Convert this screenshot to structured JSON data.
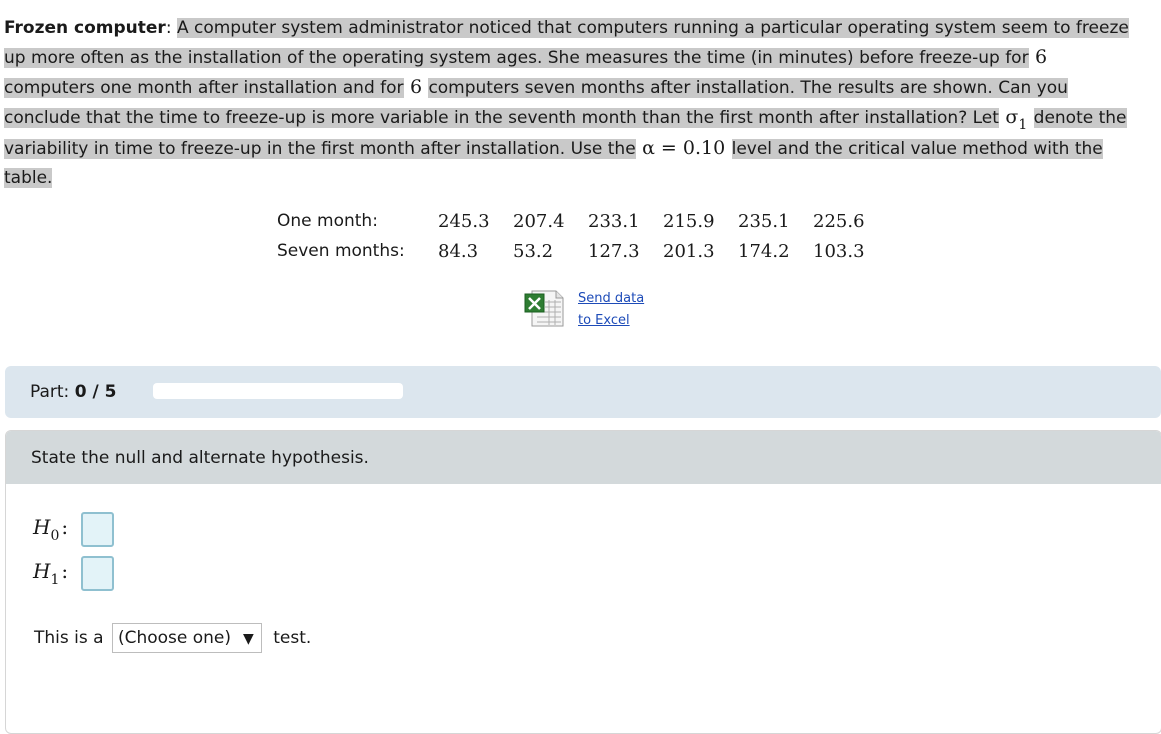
{
  "problem": {
    "title": "Frozen computer",
    "colon": ":",
    "text_part1": "A computer system administrator noticed that computers running a particular operating system seem to freeze up more often as the installation of the operating system ages. She measures the time (in minutes) before freeze-up for",
    "n1": "6",
    "text_part2": "computers one month after installation and for",
    "n2": "6",
    "text_part3": "computers seven months after installation. The results are shown. Can you conclude that the time to freeze-up is more variable in the seventh month than the first month after installation? Let",
    "sigma_symbol": "σ",
    "sigma_sub": "1",
    "text_part4": "denote the variability in time to freeze-up in the first month after installation. Use the",
    "alpha_expr": "α = 0.10",
    "text_part5": "level and the critical value method with the table."
  },
  "data_table": {
    "rows": [
      {
        "label": "One month:",
        "values": [
          "245.3",
          "207.4",
          "233.1",
          "215.9",
          "235.1",
          "225.6"
        ]
      },
      {
        "label": "Seven months:",
        "values": [
          "84.3",
          "53.2",
          "127.3",
          "201.3",
          "174.2",
          "103.3"
        ]
      }
    ]
  },
  "excel": {
    "icon": "excel-spreadsheet-icon",
    "link_line1": "Send data",
    "link_line2": "to Excel",
    "icon_color": "#2e7d32"
  },
  "part": {
    "label": "Part:",
    "value": "0 / 5",
    "progress_fraction": 0.0
  },
  "question": {
    "prompt": "State the null and alternate hypothesis.",
    "h0_symbol": "H",
    "h0_sub": "0",
    "h1_symbol": "H",
    "h1_sub": "1",
    "colon": ":",
    "test_prefix": "This is a",
    "test_select_value": "(Choose one)",
    "test_suffix": "test."
  },
  "colors": {
    "highlight": "#c9c9c9",
    "part_bar": "#dce6ee",
    "card_header": "#d3d9db",
    "answer_box": "#e3f3f8",
    "link": "#1d4bb8"
  }
}
